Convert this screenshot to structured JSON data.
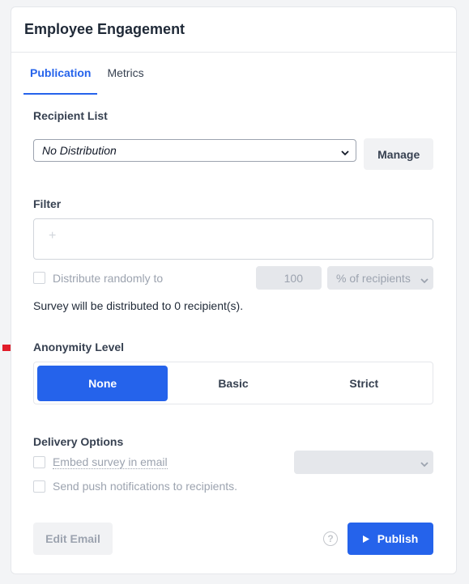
{
  "card": {
    "title": "Employee Engagement"
  },
  "tabs": [
    {
      "label": "Publication",
      "active": true
    },
    {
      "label": "Metrics",
      "active": false
    }
  ],
  "recipient": {
    "label": "Recipient List",
    "selected": "No Distribution",
    "manage_label": "Manage"
  },
  "filter": {
    "label": "Filter",
    "plus_symbol": "+",
    "distribute_label": "Distribute randomly to",
    "amount": "100",
    "unit": "% of recipients",
    "summary": "Survey will be distributed to 0 recipient(s)."
  },
  "anonymity": {
    "label": "Anonymity Level",
    "options": [
      {
        "label": "None",
        "active": true
      },
      {
        "label": "Basic",
        "active": false
      },
      {
        "label": "Strict",
        "active": false
      }
    ]
  },
  "delivery": {
    "label": "Delivery Options",
    "embed_label": "Embed survey in email",
    "push_label": "Send push notifications to recipients.",
    "embed_select": ""
  },
  "footer": {
    "edit_email_label": "Edit Email",
    "help_symbol": "?",
    "publish_label": "Publish"
  },
  "colors": {
    "accent": "#2563eb",
    "arrow": "#e11d2a"
  },
  "icons": [
    "chevron-down-icon",
    "plus-icon",
    "help-icon",
    "play-icon",
    "arrow-right-icon"
  ]
}
